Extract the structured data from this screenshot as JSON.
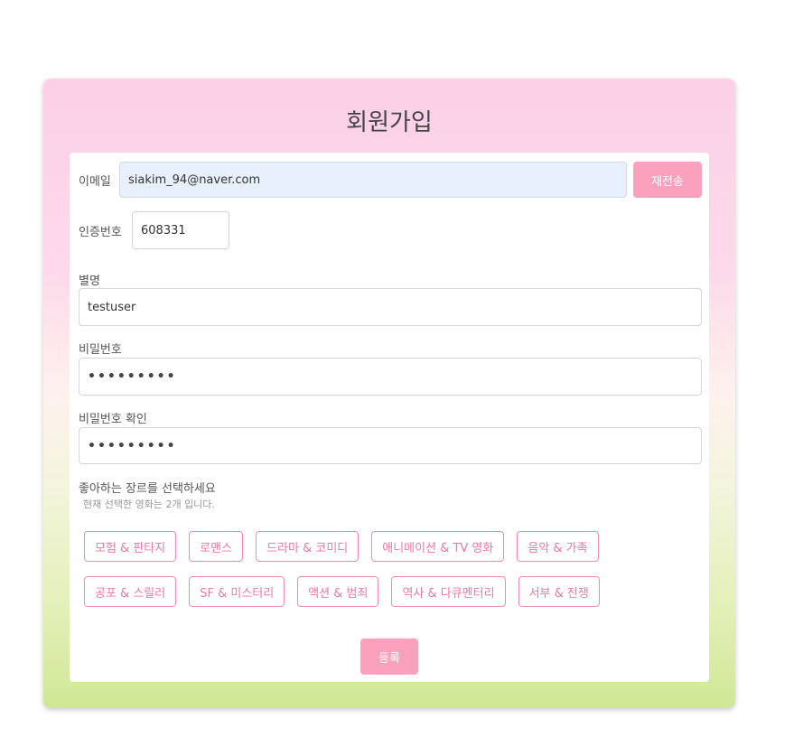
{
  "title": "회원가입",
  "email": {
    "label": "이메일",
    "value": "siakim_94@naver.com",
    "resend_label": "재전송"
  },
  "code": {
    "label": "인증번호",
    "value": "608331"
  },
  "nickname": {
    "label": "별명",
    "value": "testuser"
  },
  "password": {
    "label": "비밀번호",
    "value": "•••••••••"
  },
  "password_confirm": {
    "label": "비밀번호 확인",
    "value": "•••••••••"
  },
  "genre": {
    "prompt": "좋아하는 장르를 선택하세요",
    "hint": "현재 선택한 영화는 2개 입니다.",
    "row1": [
      "모험 & 판타지",
      "로맨스",
      "드라마 & 코미디",
      "애니메이션 & TV 영화",
      "음악 & 가족"
    ],
    "row2": [
      "공포 & 스릴러",
      "SF & 미스터리",
      "액션 & 범죄",
      "역사 & 다큐멘터리",
      "서부 & 전쟁"
    ]
  },
  "submit_label": "등록",
  "colors": {
    "accent": "#f9a1bd",
    "genre_border": "#f08bb0",
    "autofill": "#e8f0fe"
  }
}
